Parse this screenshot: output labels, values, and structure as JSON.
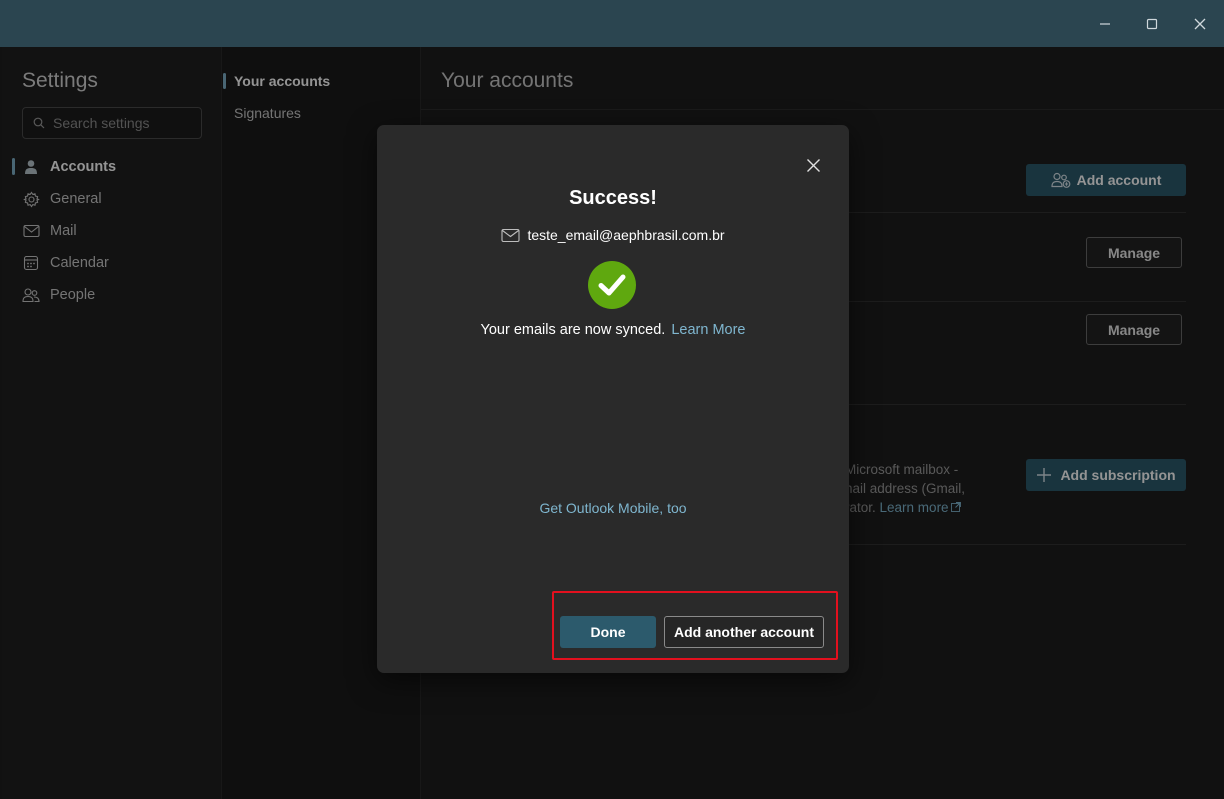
{
  "window": {
    "minimize_icon": "minimize-icon",
    "maximize_icon": "maximize-icon",
    "close_icon": "close-icon"
  },
  "sidebar": {
    "title": "Settings",
    "search_placeholder": "Search settings",
    "items": [
      {
        "label": "Accounts",
        "icon": "person-icon",
        "active": true
      },
      {
        "label": "General",
        "icon": "gear-icon"
      },
      {
        "label": "Mail",
        "icon": "mail-icon"
      },
      {
        "label": "Calendar",
        "icon": "calendar-icon"
      },
      {
        "label": "People",
        "icon": "people-icon"
      }
    ]
  },
  "subnav": {
    "items": [
      {
        "label": "Your accounts",
        "active": true
      },
      {
        "label": "Signatures"
      }
    ]
  },
  "main": {
    "title": "Your accounts",
    "add_account_label": "Add account",
    "manage_label": "Manage",
    "add_subscription_label": "Add subscription",
    "desc_line1": "Microsoft mailbox -",
    "desc_line2": "nail address (Gmail,",
    "desc_line3": "rator.",
    "learn_more": "Learn more"
  },
  "dialog": {
    "title": "Success!",
    "email": "teste_email@aephbrasil.com.br",
    "synced_text": "Your emails are now synced.",
    "learn_more": "Learn More",
    "mobile_link": "Get Outlook Mobile, too",
    "done_label": "Done",
    "add_another_label": "Add another account"
  },
  "colors": {
    "accent": "#2c5a6c",
    "link": "#7fb6cf",
    "success": "#5fa80f",
    "highlight": "#e3101e"
  }
}
